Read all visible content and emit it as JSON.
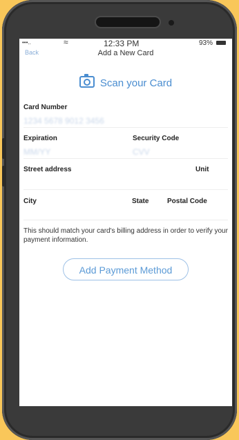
{
  "status_bar": {
    "carrier": "•••..",
    "time": "12:33 PM",
    "battery": "93%"
  },
  "nav": {
    "back_label": "Back",
    "title": "Add a New Card"
  },
  "scan": {
    "label": "Scan your Card",
    "icon": "camera-icon"
  },
  "form": {
    "card_number_label": "Card Number",
    "card_number_value": "1234 5678 9012 3456",
    "expiration_label": "Expiration",
    "expiration_value": "MM/YY",
    "security_code_label": "Security Code",
    "security_code_value": "CVV",
    "street_label": "Street address",
    "unit_label": "Unit",
    "city_label": "City",
    "state_label": "State",
    "postal_label": "Postal Code"
  },
  "note": "This should match your card's billing address in order to verify your payment information.",
  "actions": {
    "add_payment_label": "Add Payment Method"
  },
  "colors": {
    "background": "#f9c75a",
    "accent": "#4a8dd0",
    "phone_body": "#3a3a3a"
  }
}
